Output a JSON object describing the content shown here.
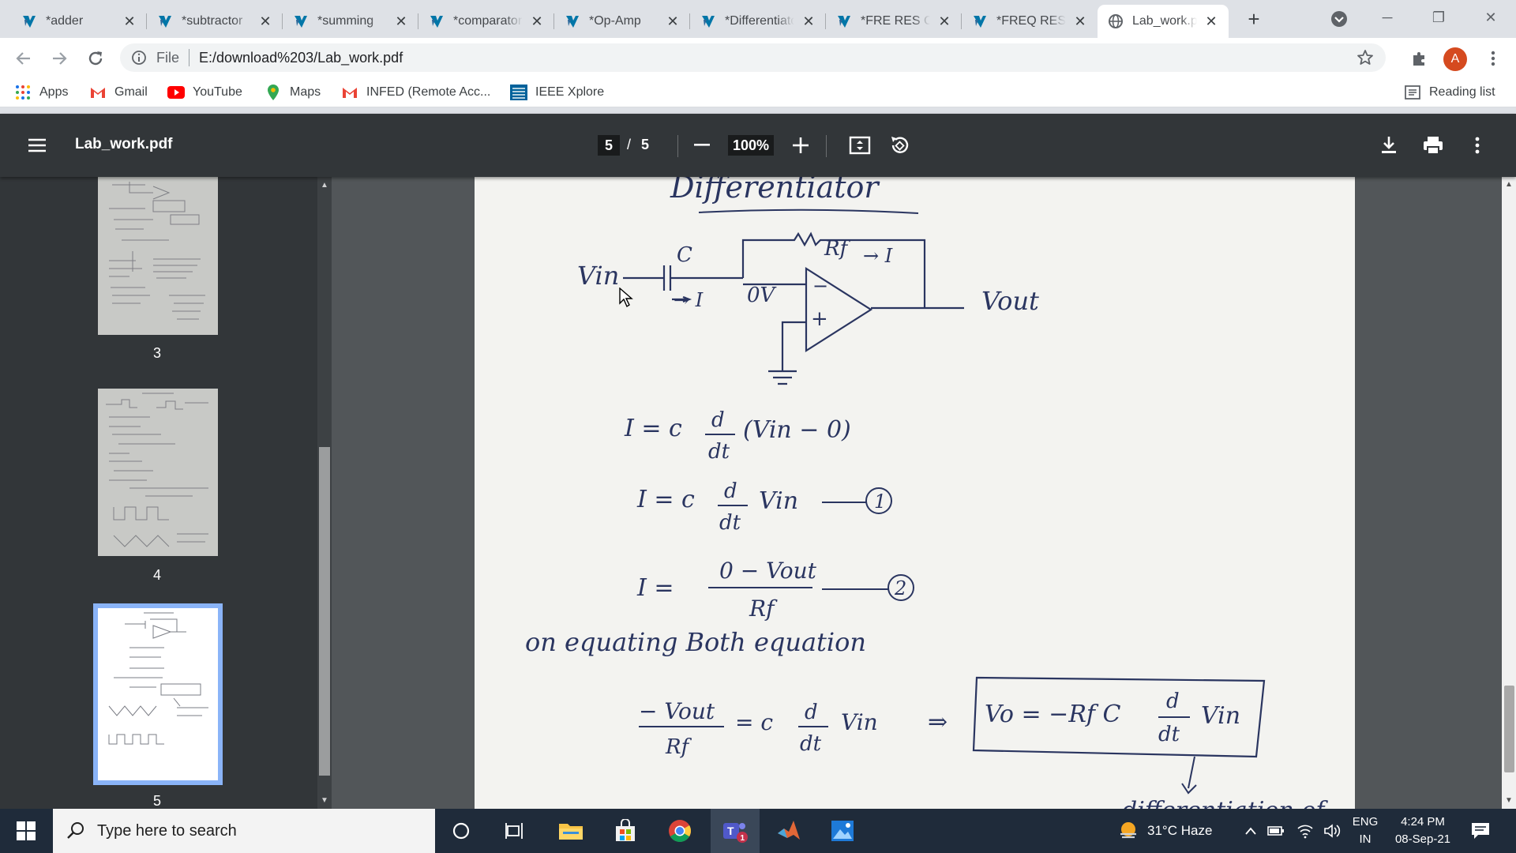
{
  "tabs": [
    {
      "title": "*adder",
      "icon": "matlab-icon"
    },
    {
      "title": "*subtractor",
      "icon": "matlab-icon"
    },
    {
      "title": "*summing",
      "icon": "matlab-icon"
    },
    {
      "title": "*comparator",
      "icon": "matlab-icon"
    },
    {
      "title": "*Op-Amp",
      "icon": "matlab-icon"
    },
    {
      "title": "*Differentiator",
      "icon": "matlab-icon"
    },
    {
      "title": "*FRE RES C",
      "icon": "matlab-icon"
    },
    {
      "title": "*FREQ RES",
      "icon": "matlab-icon"
    },
    {
      "title": "Lab_work.pdf",
      "icon": "globe-icon",
      "active": true
    }
  ],
  "toolbar": {
    "scheme": "File",
    "url": "E:/download%203/Lab_work.pdf",
    "avatar_letter": "A"
  },
  "bookmarks": [
    {
      "label": "Apps",
      "icon": "apps-grid-icon"
    },
    {
      "label": "Gmail",
      "icon": "gmail-icon"
    },
    {
      "label": "YouTube",
      "icon": "youtube-icon"
    },
    {
      "label": "Maps",
      "icon": "maps-icon"
    },
    {
      "label": "INFED (Remote Acc...",
      "icon": "gmail-icon"
    },
    {
      "label": "IEEE Xplore",
      "icon": "ieee-icon"
    }
  ],
  "reading_list": "Reading list",
  "pdf": {
    "filename": "Lab_work.pdf",
    "current_page": "5",
    "separator": "/",
    "total_pages": "5",
    "zoom": "100%",
    "thumbnails": [
      {
        "number": "3"
      },
      {
        "number": "4"
      },
      {
        "number": "5",
        "active": true
      }
    ]
  },
  "document": {
    "heading": "Differentiator",
    "labels": {
      "c": "C",
      "rf": "Rf",
      "arrow_i": "→ I",
      "vin": "Vin",
      "current_i": "→ I",
      "zero_v": "0V",
      "minus": "−",
      "plus": "+",
      "vout": "Vout"
    },
    "eq1": {
      "lhs": "I = c",
      "num": "d",
      "den": "dt",
      "rhs": "(Vin − 0)"
    },
    "eq2": {
      "lhs": "I = c",
      "num": "d",
      "den": "dt",
      "rhs": "Vin",
      "tag": "1"
    },
    "eq3": {
      "lhs": "I =",
      "num": "0 − Vout",
      "den": "Rf",
      "tag": "2"
    },
    "note": "on equating Both equation",
    "eq4": {
      "num": "− Vout",
      "den": "Rf",
      "mid": "= c",
      "dnum": "d",
      "dden": "dt",
      "rhs": "Vin",
      "implies": "⇒"
    },
    "boxed": {
      "lhs": "Vo = −Rf C",
      "num": "d",
      "den": "dt",
      "rhs": "Vin"
    },
    "cut_text": "differentiation of"
  },
  "taskbar": {
    "search_placeholder": "Type here to search",
    "weather": "31°C  Haze",
    "language": "ENG",
    "region": "IN",
    "time": "4:24 PM",
    "date": "08-Sep-21"
  },
  "colors": {
    "tabstrip": "#dee1e6",
    "pdf_toolbar": "#323639",
    "viewer_bg": "#525659",
    "ink": "#2a3560",
    "thumb_highlight": "#8ab4f8",
    "taskbar": "#1f2b3a"
  }
}
